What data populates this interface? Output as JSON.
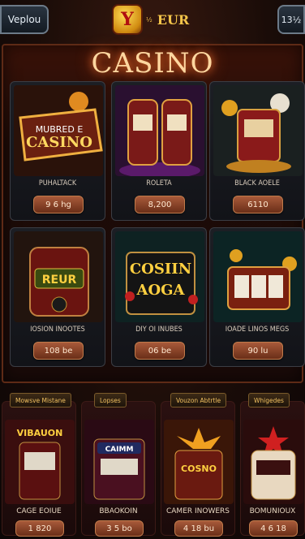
{
  "header": {
    "left_button": "Veplou",
    "right_button": "13½",
    "logo_badge": "Y",
    "logo_small": "½",
    "logo_text": "EUR"
  },
  "title": "CASINO",
  "grid": [
    {
      "label": "PUHALTACK",
      "value": "9 6 hg"
    },
    {
      "label": "ROLETA",
      "value": "8,200"
    },
    {
      "label": "BLACK AOELE",
      "value": "6110"
    },
    {
      "label": "IOSION INOOTES",
      "value": "108 be"
    },
    {
      "label": "DIY OI INUBES",
      "value": "06 be"
    },
    {
      "label": "IOADE LINOS MEGS",
      "value": "90 lu"
    }
  ],
  "bottom": [
    {
      "tag": "Mowsve Mistane",
      "label": "CAGE EOIUE",
      "value": "1 820"
    },
    {
      "tag": "Lopses",
      "label": "BBAOKOIN",
      "value": "3 5 bo"
    },
    {
      "tag": "Vouzon Abtrtle",
      "label": "CAMER INOWERS",
      "value": "4 18 bu"
    },
    {
      "tag": "Whigedes",
      "label": "BOMUNIOUX",
      "value": "4 6 18"
    }
  ],
  "art_text": {
    "card1": [
      "MUBRED E",
      "CASINO"
    ],
    "card4": "REUR",
    "card5": [
      "COSIIN",
      "AOGA"
    ],
    "b1": "VIBAUON",
    "b2": "CAIMM",
    "b3": "COSNO"
  },
  "colors": {
    "accent": "#f3c44a",
    "button": "#a85a3a",
    "panel": "#1e0b07"
  }
}
